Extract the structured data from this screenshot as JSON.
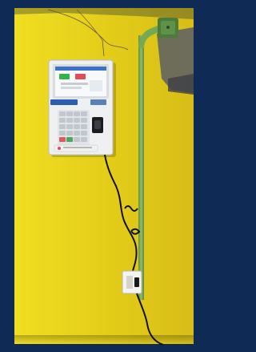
{
  "photo": {
    "subject": "wall-mounted-biometric-attendance-terminal",
    "colors": {
      "frame_blue": "#0f2a55",
      "wall_yellow": "#e6d21a",
      "conduit_green": "#7fae5a",
      "device_white": "#eef0f2",
      "screen_bg": "#f7f9fb",
      "screen_header": "#3a73c9",
      "screen_tile_green": "#33b44a",
      "screen_tile_red": "#e34b5a",
      "label_blue": "#2d5fb0",
      "cable_black": "#111111"
    }
  }
}
